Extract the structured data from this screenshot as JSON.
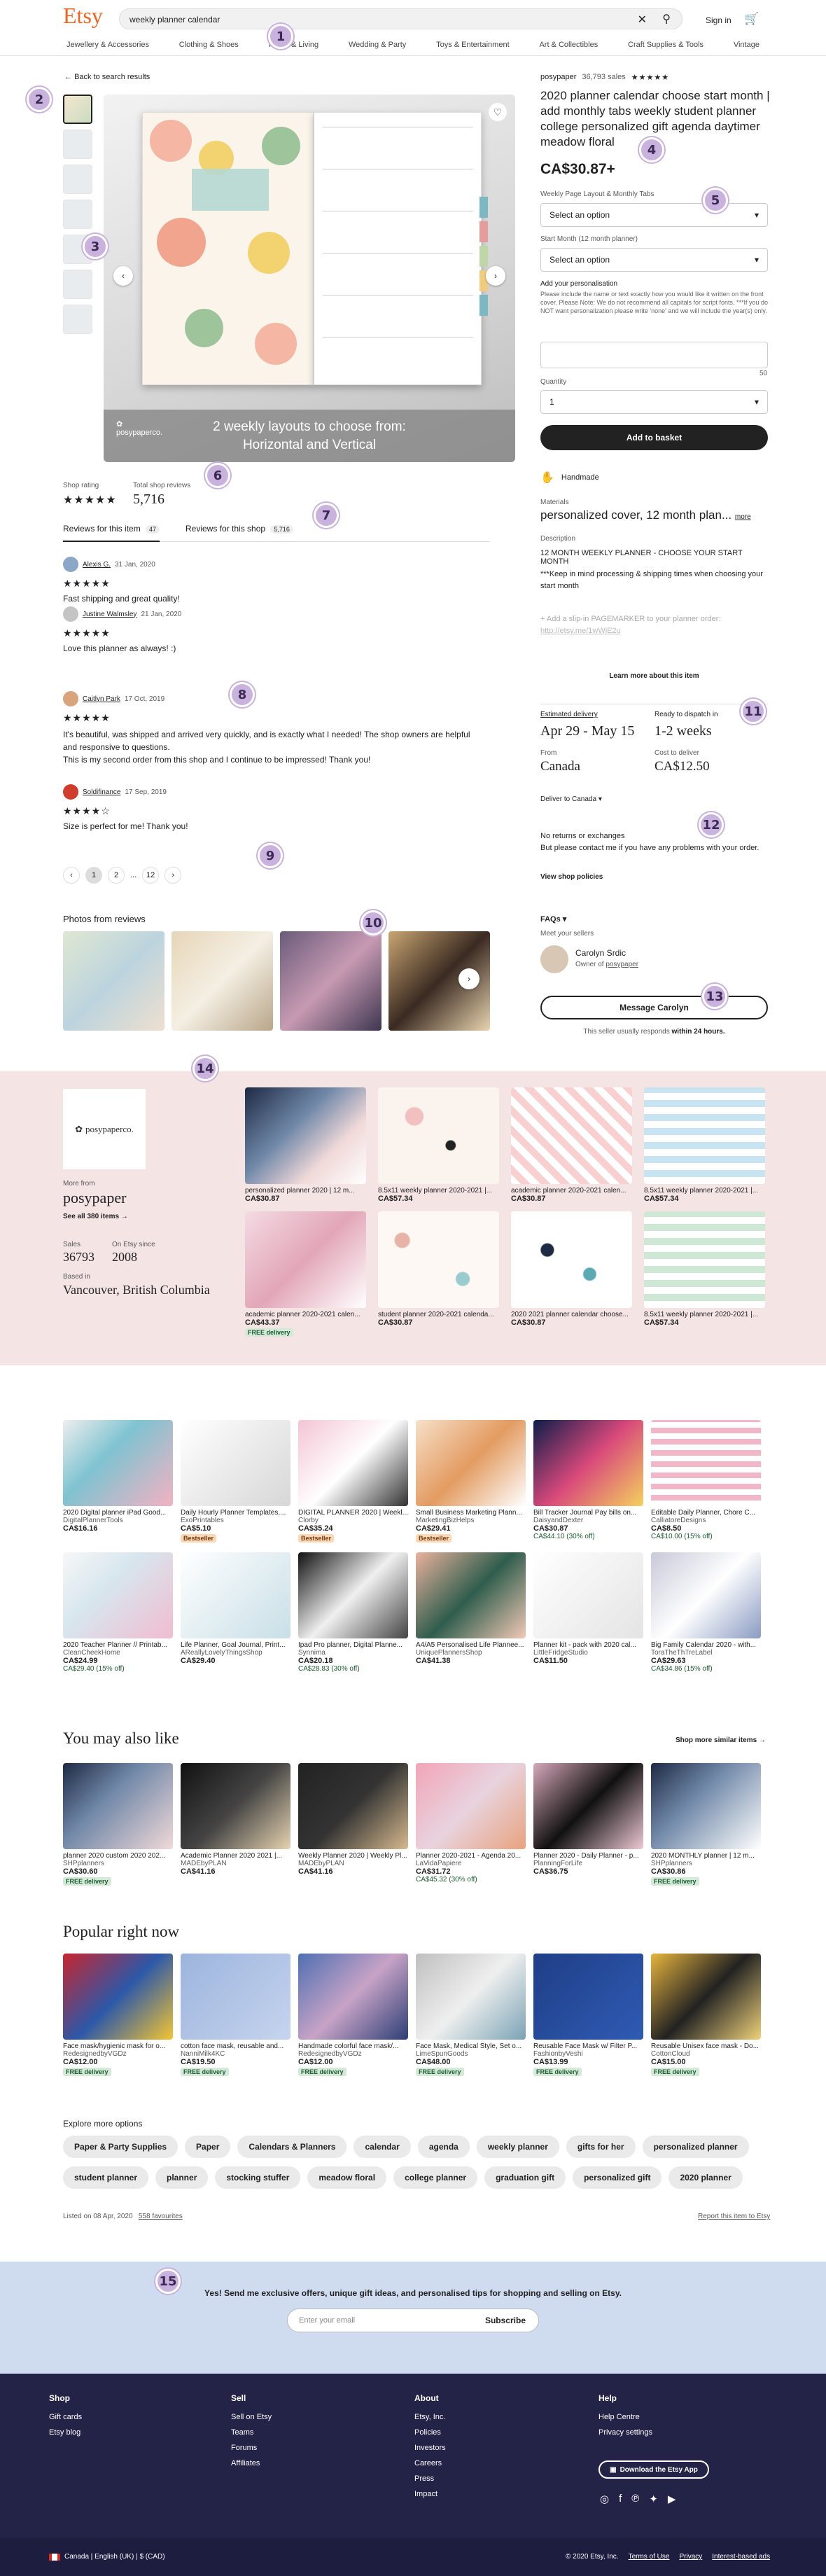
{
  "header": {
    "logo": "Etsy",
    "search_value": "weekly planner calendar",
    "sign_in": "Sign in",
    "nav": [
      "Jewellery & Accessories",
      "Clothing & Shoes",
      "Home & Living",
      "Wedding & Party",
      "Toys & Entertainment",
      "Art & Collectibles",
      "Craft Supplies & Tools",
      "Vintage"
    ]
  },
  "listing": {
    "back_link": "Back to search results",
    "hero_caption_1": "2 weekly layouts to choose from:",
    "hero_caption_2": "Horizontal and Vertical",
    "shop_name": "posypaper",
    "sales": "36,793 sales",
    "title": "2020 planner calendar choose start month | add monthly tabs weekly student planner college personalized gift agenda daytimer meadow floral",
    "price": "CA$30.87+",
    "option1_label": "Weekly Page Layout & Monthly Tabs",
    "option1_value": "Select an option",
    "option2_label": "Start Month (12 month planner)",
    "option2_value": "Select an option",
    "personalization_label": "Add your personalisation",
    "personalization_help": "Please include the name or text exactly how you would like it written on the front cover. Please Note: We do not recommend all capitals for script fonts. ***If you do NOT want personalization please write 'none' and we will include the year(s) only.",
    "char_count": "50",
    "quantity_label": "Quantity",
    "quantity_value": "1",
    "add_to_basket": "Add to basket",
    "handmade": "Handmade",
    "materials_label": "Materials",
    "materials_value": "personalized cover, 12 month plan...",
    "more": "more",
    "description_label": "Description",
    "description_1": "12 MONTH WEEKLY PLANNER - CHOOSE YOUR START MONTH",
    "description_2": "***Keep in mind processing & shipping times when choosing your start month",
    "description_3": "+ Add a slip-in PAGEMARKER to your planner order:",
    "description_link": "http://etsy.me/1wWjE2u",
    "learn_more": "Learn more about this item",
    "est_delivery_label": "Estimated delivery",
    "est_delivery": "Apr 29 - May 15",
    "dispatch_label": "Ready to dispatch in",
    "dispatch": "1-2 weeks",
    "from_label": "From",
    "from": "Canada",
    "cost_label": "Cost to deliver",
    "cost": "CA$12.50",
    "deliver_to": "Deliver to Canada",
    "returns_title": "No returns or exchanges",
    "returns_text": "But please contact me if you have any problems with your order.",
    "view_policies": "View shop policies",
    "faqs": "FAQs",
    "meet_seller": "Meet your sellers",
    "seller_name": "Carolyn Srdic",
    "seller_role": "Owner of",
    "seller_shop": "posypaper",
    "message_btn": "Message Carolyn",
    "responds_1": "This seller usually responds",
    "responds_2": "within 24 hours."
  },
  "reviews": {
    "shop_rating_label": "Shop rating",
    "total_label": "Total shop reviews",
    "total": "5,716",
    "tab_item": "Reviews for this item",
    "tab_item_count": "47",
    "tab_shop": "Reviews for this shop",
    "tab_shop_count": "5,716",
    "items": [
      {
        "name": "Alexis G.",
        "date": "31 Jan, 2020",
        "text": "Fast shipping and great quality!",
        "stars": "★★★★★"
      },
      {
        "name": "Justine Walmsley",
        "date": "21 Jan, 2020",
        "text": "Love this planner as always! :)",
        "stars": "★★★★★"
      },
      {
        "name": "Caitlyn Park",
        "date": "17 Oct, 2019",
        "text": "It's beautiful, was shipped and arrived very quickly, and is exactly what I needed! The shop owners are helpful and responsive to questions.\nThis is my second order from this shop and I continue to be impressed! Thank you!",
        "stars": "★★★★★"
      },
      {
        "name": "Soldifinance",
        "date": "17 Sep, 2019",
        "text": "Size is perfect for me! Thank you!",
        "stars": "★★★★☆"
      }
    ],
    "pages": [
      "1",
      "2",
      "...",
      "12"
    ],
    "photos_title": "Photos from reviews"
  },
  "shop_section": {
    "more_from": "More from",
    "shop": "posypaper",
    "see_all": "See all 380 items",
    "sales_label": "Sales",
    "sales": "36793",
    "since_label": "On Etsy since",
    "since": "2008",
    "based_label": "Based in",
    "based": "Vancouver, British Columbia",
    "logo_text": "posypaperco.",
    "items": [
      {
        "title": "personalized planner 2020 | 12 m...",
        "price": "CA$30.87",
        "free": ""
      },
      {
        "title": "8.5x11 weekly planner 2020-2021 |...",
        "price": "CA$57.34",
        "free": ""
      },
      {
        "title": "academic planner 2020-2021 calen...",
        "price": "CA$30.87",
        "free": ""
      },
      {
        "title": "8.5x11 weekly planner 2020-2021 |...",
        "price": "CA$57.34",
        "free": ""
      },
      {
        "title": "academic planner 2020-2021 calen...",
        "price": "CA$43.37",
        "free": "FREE delivery"
      },
      {
        "title": "student planner 2020-2021 calenda...",
        "price": "CA$30.87",
        "free": ""
      },
      {
        "title": "2020 2021 planner calendar choose...",
        "price": "CA$30.87",
        "free": ""
      },
      {
        "title": "8.5x11 weekly planner 2020-2021 |...",
        "price": "CA$57.34",
        "free": ""
      }
    ]
  },
  "ads_grid": [
    {
      "title": "2020 Digital planner iPad Good...",
      "shop": "DigitalPlannerTools",
      "price": "CA$16.16",
      "old": "",
      "badge": ""
    },
    {
      "title": "Daily Hourly Planner Templates,...",
      "shop": "ExoPrintables",
      "price": "CA$5.10",
      "old": "",
      "badge": "Bestseller"
    },
    {
      "title": "DIGITAL PLANNER 2020 | Weekl...",
      "shop": "Clorby",
      "price": "CA$35.24",
      "old": "",
      "badge": "Bestseller"
    },
    {
      "title": "Small Business Marketing Plann...",
      "shop": "MarketingBizHelps",
      "price": "CA$29.41",
      "old": "",
      "badge": "Bestseller"
    },
    {
      "title": "Bill Tracker Journal Pay bills on...",
      "shop": "DaisyandDexter",
      "price": "CA$30.87",
      "old": "CA$44.10 (30% off)",
      "badge": ""
    },
    {
      "title": "Editable Daily Planner, Chore C...",
      "shop": "CalliatoreDesigns",
      "price": "CA$8.50",
      "old": "CA$10.00 (15% off)",
      "badge": ""
    },
    {
      "title": "2020 Teacher Planner // Printab...",
      "shop": "CleanCheekHome",
      "price": "CA$24.99",
      "old": "CA$29.40 (15% off)",
      "badge": ""
    },
    {
      "title": "Life Planner, Goal Journal, Print...",
      "shop": "AReallyLovelyThingsShop",
      "price": "CA$29.40",
      "old": "",
      "badge": ""
    },
    {
      "title": "Ipad Pro planner, Digital Planne...",
      "shop": "Synnima",
      "price": "CA$20.18",
      "old": "CA$28.83 (30% off)",
      "badge": ""
    },
    {
      "title": "A4/A5 Personalised Life Plannee...",
      "shop": "UniquePlannersShop",
      "price": "CA$41.38",
      "old": "",
      "badge": ""
    },
    {
      "title": "Planner kit - pack with 2020 cal...",
      "shop": "LittleFridgeStudio",
      "price": "CA$11.50",
      "old": "",
      "badge": ""
    },
    {
      "title": "Big Family Calendar 2020 - with...",
      "shop": "ToraTheThTreLabel",
      "price": "CA$29.63",
      "old": "CA$34.86 (15% off)",
      "badge": ""
    }
  ],
  "also_like": {
    "title": "You may also like",
    "shop_more": "Shop more similar items",
    "items": [
      {
        "title": "planner 2020 custom 2020 202...",
        "shop": "SHPplanners",
        "price": "CA$30.60",
        "old": "",
        "free": "FREE delivery"
      },
      {
        "title": "Academic Planner 2020 2021 |...",
        "shop": "MADEbyPLAN",
        "price": "CA$41.16",
        "old": "",
        "free": ""
      },
      {
        "title": "Weekly Planner 2020 | Weekly Pl...",
        "shop": "MADEbyPLAN",
        "price": "CA$41.16",
        "old": "",
        "free": ""
      },
      {
        "title": "Planner 2020-2021 - Agenda 20...",
        "shop": "LaVidaPapiere",
        "price": "CA$31.72",
        "old": "CA$45.32 (30% off)",
        "free": ""
      },
      {
        "title": "Planner 2020 - Daily Planner - p...",
        "shop": "PlanningForLife",
        "price": "CA$36.75",
        "old": "",
        "free": ""
      },
      {
        "title": "2020 MONTHLY planner | 12 m...",
        "shop": "SHPplanners",
        "price": "CA$30.86",
        "old": "",
        "free": "FREE delivery"
      }
    ]
  },
  "popular": {
    "title": "Popular right now",
    "items": [
      {
        "title": "Face mask/hygienic mask for o...",
        "shop": "RedesignedbyVGDz",
        "price": "CA$12.00",
        "free": "FREE delivery"
      },
      {
        "title": "cotton face mask, reusable and...",
        "shop": "NanniMilk4KC",
        "price": "CA$19.50",
        "free": "FREE delivery"
      },
      {
        "title": "Handmade colorful face mask/...",
        "shop": "RedesignedbyVGDz",
        "price": "CA$12.00",
        "free": "FREE delivery"
      },
      {
        "title": "Face Mask, Medical Style, Set o...",
        "shop": "LimeSpunGoods",
        "price": "CA$48.00",
        "free": "FREE delivery"
      },
      {
        "title": "Reusable Face Mask w/ Filter P...",
        "shop": "FashionbyVeshi",
        "price": "CA$13.99",
        "free": "FREE delivery"
      },
      {
        "title": "Reusable Unisex face mask - Do...",
        "shop": "CottonCloud",
        "price": "CA$15.00",
        "free": "FREE delivery"
      }
    ]
  },
  "explore": {
    "title": "Explore more options",
    "tags": [
      "Paper & Party Supplies",
      "Paper",
      "Calendars & Planners",
      "calendar",
      "agenda",
      "weekly planner",
      "gifts for her",
      "personalized planner",
      "student planner",
      "planner",
      "stocking stuffer",
      "meadow floral",
      "college planner",
      "graduation gift",
      "personalized gift",
      "2020 planner"
    ],
    "listed": "Listed on 08 Apr, 2020",
    "favourites": "558 favourites",
    "report": "Report this item to Etsy"
  },
  "newsletter": {
    "text": "Yes! Send me exclusive offers, unique gift ideas, and personalised tips for shopping and selling on Etsy.",
    "placeholder": "Enter your email",
    "button": "Subscribe"
  },
  "footer": {
    "shop_title": "Shop",
    "shop_links": [
      "Gift cards",
      "Etsy blog"
    ],
    "sell_title": "Sell",
    "sell_links": [
      "Sell on Etsy",
      "Teams",
      "Forums",
      "Affiliates"
    ],
    "about_title": "About",
    "about_links": [
      "Etsy, Inc.",
      "Policies",
      "Investors",
      "Careers",
      "Press",
      "Impact"
    ],
    "help_title": "Help",
    "help_links": [
      "Help Centre",
      "Privacy settings"
    ],
    "app_button": "Download the Etsy App",
    "locale": "Canada  |  English (UK)  |  $ (CAD)",
    "copyright": "© 2020 Etsy, Inc.",
    "terms": "Terms of Use",
    "privacy": "Privacy",
    "ads": "Interest-based ads"
  },
  "colors": {
    "accent": "#f1641e",
    "dark": "#222222",
    "marker": "#c9b2dd",
    "shop_band": "#f4e4e3",
    "newsletter": "#cfdcf0",
    "footer": "#232347"
  },
  "markers": [
    "1",
    "2",
    "3",
    "4",
    "5",
    "6",
    "7",
    "8",
    "9",
    "10",
    "11",
    "12",
    "13",
    "14",
    "15"
  ]
}
